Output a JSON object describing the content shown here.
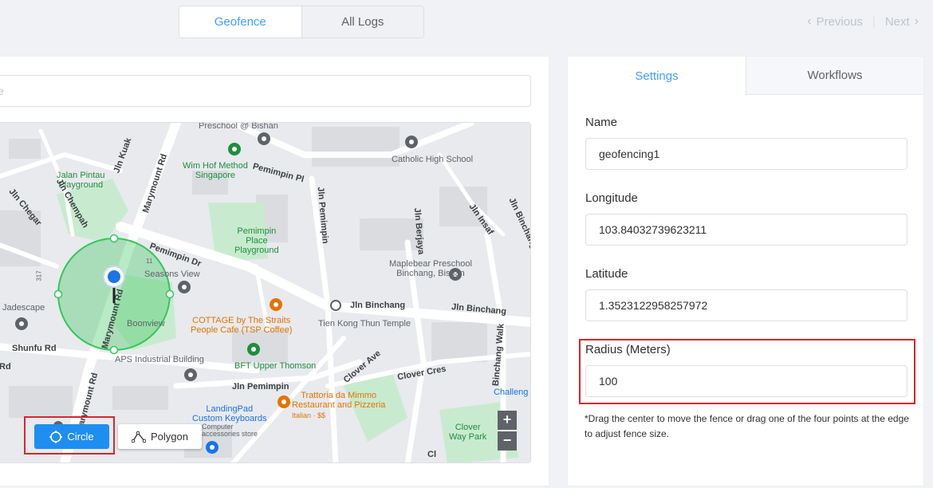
{
  "top_tabs": [
    "Geofence",
    "All Logs"
  ],
  "pager": {
    "previous": "Previous",
    "next": "Next"
  },
  "search": {
    "placeholder": "e"
  },
  "map": {
    "labels": {
      "preschool_bishan": "Preschool @ Bishan",
      "wim_hof": "Wim Hof Method\nSingapore",
      "catholic_high": "Catholic High School",
      "jalan_pintau": "Jalan Pintau\nPlayground",
      "jln_kuak": "Jln Kuak",
      "marymount_rd_top": "Marymount Rd",
      "pemimpin_pl": "Pemimpin Pl",
      "jln_chegar": "Jln Chegar",
      "jln_chempah": "Jln Chempah",
      "jln_pemimpin_v": "Jln Pemimpin",
      "jln_berjaya_v": "Jln Berjaya",
      "jln_insaf": "Jln Insaf",
      "jln_binchang_v": "Jln Binchang",
      "pemimpin_place_pg": "Pemimpin\nPlace\nPlayground",
      "pemimpin_dr": "Pemimpin Dr",
      "maplebear": "Maplebear Preschool\nBinchang, Bishan",
      "seasons_view": "Seasons View",
      "num_317": "317",
      "num_11": "11",
      "jadescape": "Jadescape",
      "marymount_rd_mid": "Marymount Rd",
      "boonview": "Boonview",
      "cottage": "COTTAGE by The Straits\nPeople Cafe (TSP Coffee)",
      "jln_binchang_1": "Jln Binchang",
      "jln_binchang_2": "Jln Binchang",
      "tien_kong": "Tien Kong Thun Temple",
      "binchang_walk": "Binchang Walk",
      "shunfu_rd": "Shunfu Rd",
      "aps": "APS Industrial Building",
      "bft": "BFT Upper Thomson",
      "clover_ave": "Clover Ave",
      "clover_cres": "Clover Cres",
      "challeng": "Challeng",
      "jln_pemimpin_h": "Jln Pemimpin",
      "marymount_rd_low": "Marymount Rd",
      "landingpad": "LandingPad\nCustom Keyboards",
      "computer_acc": "Computer\naccessories store",
      "trattoria": "Trattoria da Mimmo\nRestaurant and Pizzeria",
      "italian": "Italian · $$",
      "clover_way_park": "Clover\nWay Park",
      "rd_fragment": "Rd",
      "cl_fragment": "Cl"
    },
    "zoom_in": "+",
    "zoom_out": "−"
  },
  "draw_tools": {
    "circle": "Circle",
    "polygon": "Polygon"
  },
  "right_tabs": [
    "Settings",
    "Workflows"
  ],
  "form": {
    "name_label": "Name",
    "name_value": "geofencing1",
    "longitude_label": "Longitude",
    "longitude_value": "103.84032739623211",
    "latitude_label": "Latitude",
    "latitude_value": "1.3523122958257972",
    "radius_label": "Radius (Meters)",
    "radius_value": "100",
    "hint": "*Drag the center to move the fence or drag one of the four points at the edge to adjust fence size."
  },
  "colors": {
    "accent": "#409eff",
    "circle_button": "#1f8ef1",
    "highlight": "#d9262d",
    "fence": "#34c759"
  }
}
